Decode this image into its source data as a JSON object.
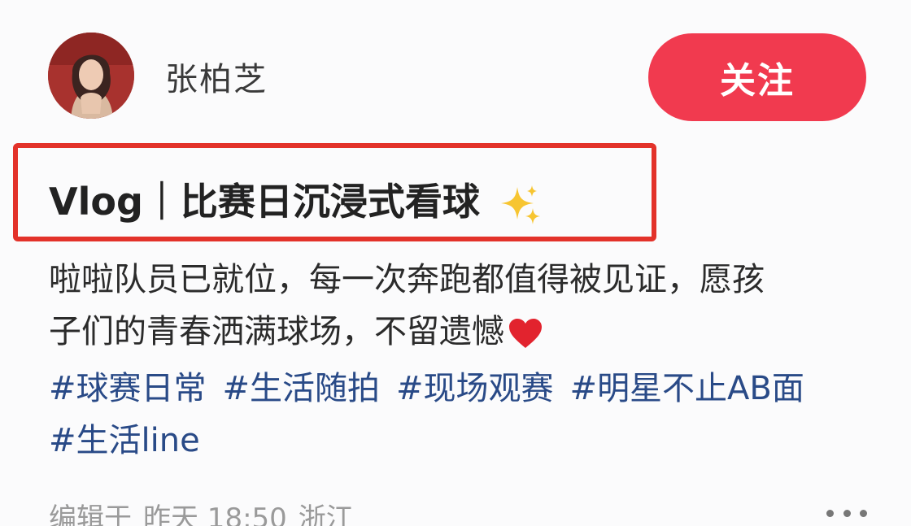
{
  "author": {
    "name": "张柏芝",
    "follow_label": "关注"
  },
  "post": {
    "title": "Vlog｜比赛日沉浸式看球",
    "title_emoji": "sparkles",
    "body_lines": [
      "啦啦队员已就位，每一次奔跑都值得被见证，愿孩",
      "子们的青春洒满球场，不留遗憾"
    ],
    "body_emoji": "red-heart",
    "tags_row1": [
      "#球赛日常",
      "#生活随拍",
      "#现场观赛",
      "#明星不止AB面"
    ],
    "tags_row2": [
      "#生活line"
    ],
    "meta": {
      "edited_prefix": "编辑于",
      "time": "昨天 18:50",
      "location": "浙江"
    }
  },
  "colors": {
    "follow_button": "#f13a4f",
    "highlight_box": "#e3322a",
    "tag_text": "#294a87",
    "meta_text": "#9a9a9a"
  },
  "icons": {
    "more": "more-dots-icon"
  }
}
